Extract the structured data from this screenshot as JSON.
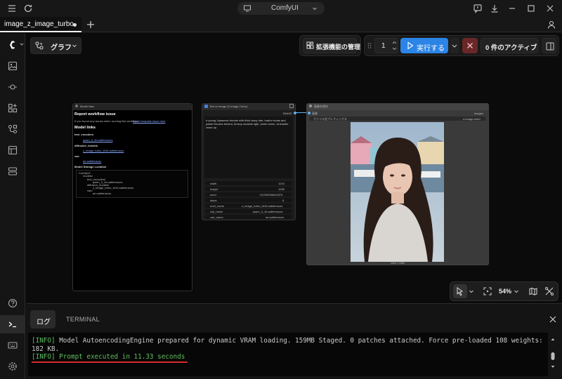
{
  "window": {
    "title": "ComfyUI"
  },
  "tab": {
    "label": "image_z_image_turbo"
  },
  "toolbar": {
    "graph_label": "グラフ",
    "extensions_label": "拡張機能の管理",
    "batch_count": "1",
    "run_label": "実行する",
    "queue_label": "0 件のアクティブ"
  },
  "canvas_controls": {
    "zoom": "54%"
  },
  "nodes": {
    "model_links": {
      "title": "Model links",
      "heading1": "Report workflow issue",
      "report_text": "If you found any issues when running this workflow,",
      "report_link": "report template issue here",
      "heading2": "Model links",
      "text_encoders_label": "text_encoders",
      "text_encoder_file": "qwen_3_4b.safetensors",
      "diffusion_models_label": "diffusion_models",
      "diffusion_model_file": "z_image_turbo_bf16.safetensors",
      "vae_label": "vae",
      "vae_file": "ae.safetensors",
      "storage_label": "Model Storage Location",
      "tree": [
        "ComfyUI/",
        "models/",
        "text_encoders/",
        "qwen_3_4b.safetensors",
        "diffusion_models/",
        "z_image_turbo_bf16.safetensors",
        "vae/",
        "ae.safetensors"
      ]
    },
    "text_to_image": {
      "title": "Text to Image (Z-Image-Turbo)",
      "output_label": "IMAGE",
      "prompt": "a young Japanese female with thick wavy hair, harbor boats and pastel houses behind, breezy seaside light, warm tones, cinematic close-up.",
      "widgets": [
        {
          "label": "width",
          "value": "1024"
        },
        {
          "label": "height",
          "value": "1536"
        },
        {
          "label": "seed",
          "value": "742205958409376"
        },
        {
          "label": "steps",
          "value": "8"
        },
        {
          "label": "unet_name",
          "value": "z_image_turbo_bf16.safetensors"
        },
        {
          "label": "clip_name",
          "value": "qwen_3_4b.safetensors"
        },
        {
          "label": "vae_name",
          "value": "ae.safetensors"
        }
      ]
    },
    "save_image": {
      "title": "画像を保存",
      "input_label": "画像",
      "input_right": "images",
      "prefix_label": "ファイル名プレフィックス",
      "prefix_value": "z-image-turbo",
      "image_size": "1024 × 1536"
    }
  },
  "bottom_panel": {
    "tabs": [
      "ログ",
      "TERMINAL"
    ],
    "log_line1_tag": "[INFO]",
    "log_line1": " Model AutoencodingEngine prepared for dynamic VRAM loading. 159MB Staged. 0 patches attached. Force pre-loaded 108 weights:",
    "log_line1b": "182 KB.",
    "log_line2": "[INFO] Prompt executed in 11.33 seconds"
  },
  "colors": {
    "accent": "#2b84e6",
    "cancel": "#6a2727",
    "log_green": "#5fbf5f",
    "underline": "#d42a2a"
  }
}
